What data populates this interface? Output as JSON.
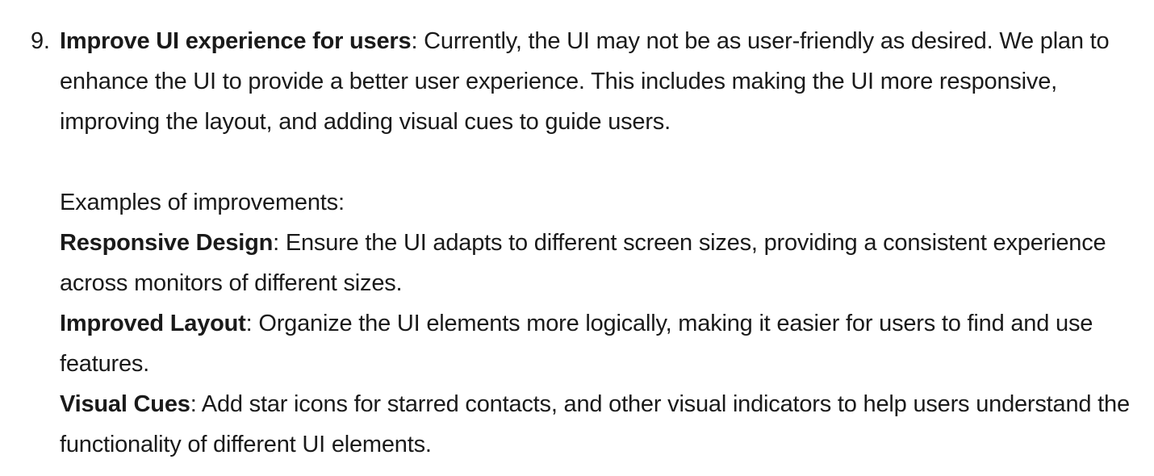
{
  "item": {
    "number": "9.",
    "title": "Improve UI experience for users",
    "separator": ":",
    "description": " Currently, the UI may not be as user-friendly as desired. We plan to enhance the UI to provide a better user experience. This includes making the UI more responsive, improving the layout, and adding visual cues to guide users.",
    "examples_heading": "Examples of improvements:",
    "examples": [
      {
        "label": "Responsive Design",
        "text": ": Ensure the UI adapts to different screen sizes, providing a consistent experience across monitors of different sizes."
      },
      {
        "label": "Improved Layout",
        "text": ": Organize the UI elements more logically, making it easier for users to find and use features."
      },
      {
        "label": "Visual Cues",
        "text": ": Add star icons for starred contacts, and other visual indicators to help users understand the functionality of different UI elements."
      }
    ]
  }
}
